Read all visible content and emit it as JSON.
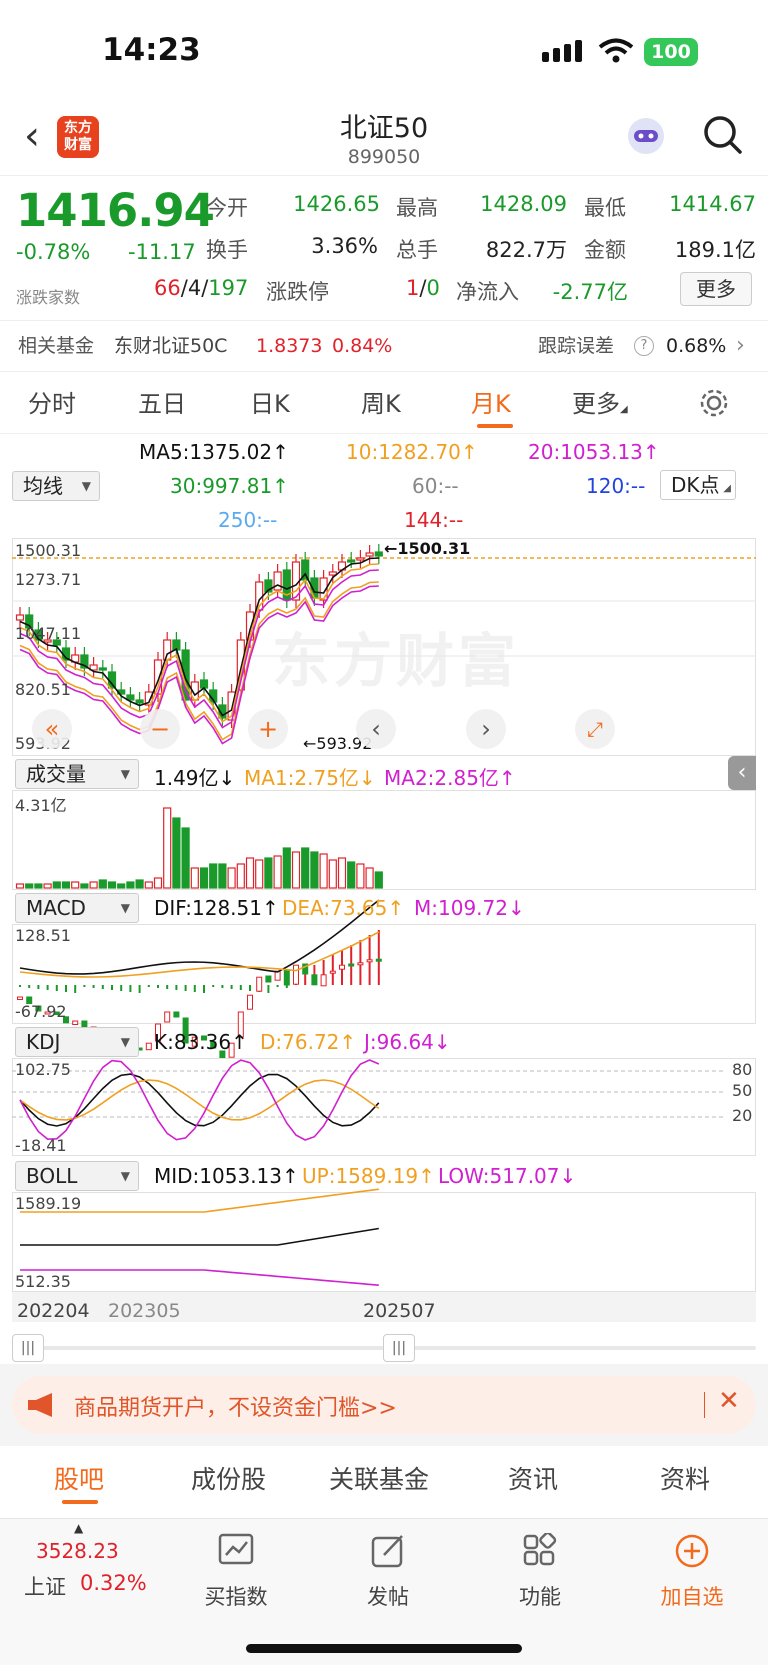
{
  "status_bar": {
    "time": "14:23",
    "battery": "100"
  },
  "header": {
    "logo_text": "东方\n财富",
    "title": "北证50",
    "code": "899050"
  },
  "quote": {
    "price": "1416.94",
    "change_pct": "-0.78%",
    "change": "-11.17",
    "open_label": "今开",
    "open": "1426.65",
    "high_label": "最高",
    "high": "1428.09",
    "low_label": "最低",
    "low": "1414.67",
    "turnover_label": "换手",
    "turnover": "3.36%",
    "volume_label": "总手",
    "volume": "822.7万",
    "amount_label": "金额",
    "amount": "189.1亿",
    "breadth_label": "涨跌家数",
    "up_count": "66",
    "flat_count": "4",
    "down_count": "197",
    "limit_label": "涨跌停",
    "limit_up": "1",
    "limit_down": "0",
    "netflow_label": "净流入",
    "netflow": "-2.77亿",
    "more_label": "更多"
  },
  "fund": {
    "label": "相关基金",
    "name": "东财北证50C",
    "nav": "1.8373",
    "pct": "0.84%",
    "tracking_label": "跟踪误差",
    "tracking": "0.68%"
  },
  "tabs": [
    "分时",
    "五日",
    "日K",
    "周K",
    "月K",
    "更多"
  ],
  "active_tab": "月K",
  "ma": {
    "selector": "均线",
    "ma5": "MA5:1375.02↑",
    "ma10": "10:1282.70↑",
    "ma20": "20:1053.13↑",
    "ma30": "30:997.81↑",
    "ma60": "60:--",
    "ma120": "120:--",
    "ma250": "250:--",
    "ma144": "144:--",
    "dk": "DK点"
  },
  "main_axis": {
    "y1": "1500.31",
    "y2": "1273.71",
    "y3": "1047.11",
    "y4": "820.51",
    "y5": "593.92",
    "high_mark": "1500.31",
    "low_mark": "←593.92",
    "high_arrow": "←"
  },
  "volume_panel": {
    "selector": "成交量",
    "value": "1.49亿↓",
    "ma1": "MA1:2.75亿↓",
    "ma2": "MA2:2.85亿↑",
    "ymax": "4.31亿"
  },
  "macd_panel": {
    "selector": "MACD",
    "dif": "DIF:128.51↑",
    "dea": "DEA:73.65↑",
    "m": "M:109.72↓",
    "ymax": "128.51",
    "ymin": "-67.92"
  },
  "kdj_panel": {
    "selector": "KDJ",
    "k": "K:83.36↑",
    "d": "D:76.72↑",
    "j": "J:96.64↓",
    "ymax": "102.75",
    "ymin": "-18.41",
    "l80": "80",
    "l50": "50",
    "l20": "20"
  },
  "boll_panel": {
    "selector": "BOLL",
    "mid": "MID:1053.13↑",
    "up": "UP:1589.19↑",
    "low": "LOW:517.07↓",
    "ymax": "1589.19",
    "ymin": "512.35"
  },
  "x_axis": {
    "start": "202204",
    "mid": "202305",
    "end": "202507"
  },
  "ad": {
    "text": "商品期货开户，不设资金门槛>>"
  },
  "bottom_tabs": [
    "股吧",
    "成份股",
    "关联基金",
    "资讯",
    "资料"
  ],
  "bottom_nav": {
    "index_value": "3528.23",
    "index_name": "上证",
    "index_pct": "0.32%",
    "buy": "买指数",
    "post": "发帖",
    "func": "功能",
    "add": "加自选"
  },
  "colors": {
    "up": "#e0222a",
    "down": "#1a9a2a",
    "accent": "#f26b1d",
    "ma10": "#f0a020",
    "ma20": "#d020d0"
  },
  "chart_data": {
    "type": "candlestick",
    "period": "monthly",
    "x": [
      "202204",
      "202205",
      "202206",
      "202207",
      "202208",
      "202209",
      "202210",
      "202211",
      "202212",
      "202301",
      "202302",
      "202303",
      "202304",
      "202305",
      "202306",
      "202307",
      "202308",
      "202309",
      "202310",
      "202311",
      "202312",
      "202401",
      "202402",
      "202403",
      "202404",
      "202405",
      "202406",
      "202407",
      "202408",
      "202409",
      "202410",
      "202411",
      "202412",
      "202501",
      "202502",
      "202503",
      "202504",
      "202505",
      "202506",
      "202507"
    ],
    "ylim": [
      593.92,
      1500.31
    ],
    "high_label": 1500.31,
    "low_label": 593.92
  }
}
